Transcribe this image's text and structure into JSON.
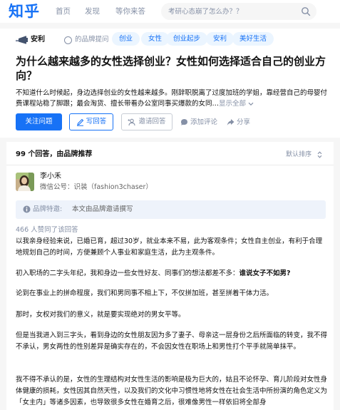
{
  "nav": {
    "logo": "知乎",
    "links": [
      "首页",
      "发现",
      "等你来答"
    ],
    "search_placeholder": "考研心态崩了怎么办？？"
  },
  "question": {
    "brand": {
      "name": "安利",
      "label": "的品牌提问"
    },
    "tags": [
      "创业",
      "女性",
      "创业起步",
      "安利",
      "美好生活"
    ],
    "title": "为什么越来越多的女性选择创业？女性如何选择适合自己的创业方向？",
    "description": "不知道什么时候起，身边选择创业的女性越来越多。刚辞职脱离了过度加班的学姐，靠经营自己的母婴付费课程站稳了脚跟；最会淘货、擅长带看办公室同事买爆款的女同…",
    "show_all": "显示全部",
    "actions": {
      "follow": "关注问题",
      "write": "写回答",
      "invite": "邀请回答",
      "comment": "添加评论",
      "share": "分享"
    }
  },
  "answers": {
    "count": "99 个回答，由品牌推荐",
    "sort": "默认排序"
  },
  "answer": {
    "author": "李小禾",
    "headline": "微信公号：识装（fashion3chaser）",
    "notice_label": "品牌特邀:",
    "notice_text": "本文由品牌邀请撰写",
    "votes": "466 人赞同了该回答",
    "paragraphs": [
      "以我亲身经验来说，已婚已育，超过30岁，就业本来不易，此为客观条件；女性自主创业，有利于合理地规划自己的时间，方便兼顾个人事业和家庭生活，此为主观条件。",
      "初入职场的二字头年纪，我和身边一些女性好友、同事们的想法都差不多：",
      "论到在事业上的拼命程度，我们和男同事不相上下，不仅拼加班，甚至拼着干体力活。",
      "那时，女权对我们的意义，就是要实现绝对的男女平等。",
      "但是当我进入到三字头，看到身边的女性朋友因为多了妻子、母亲这一层身份之后所面临的转变，我不得不承认，男女两性的性别差异是确实存在的，不会因女性在职场上和男性打个平手就简单抹平。",
      "我不得不承认的是，女性的生理结构对女性生活的影响是极为巨大的，姑且不论怀孕、育儿阶段对女性身体健康的损耗，女性因其自然天性，以及我们的文化中习惯性地将女性在社会生活中所扮演的角色定义为「女主内」等诸多因素，也导致很多女性在婚育之后，很难像男性一样依旧将全部身"
    ],
    "p2_bold": "谁说女子不如男?"
  },
  "colors": {
    "brand_blue": "#1772f6",
    "tag_bg": "#ebf5ff",
    "muted_text": "#8590a6",
    "page_bg": "#f6f6f6"
  }
}
